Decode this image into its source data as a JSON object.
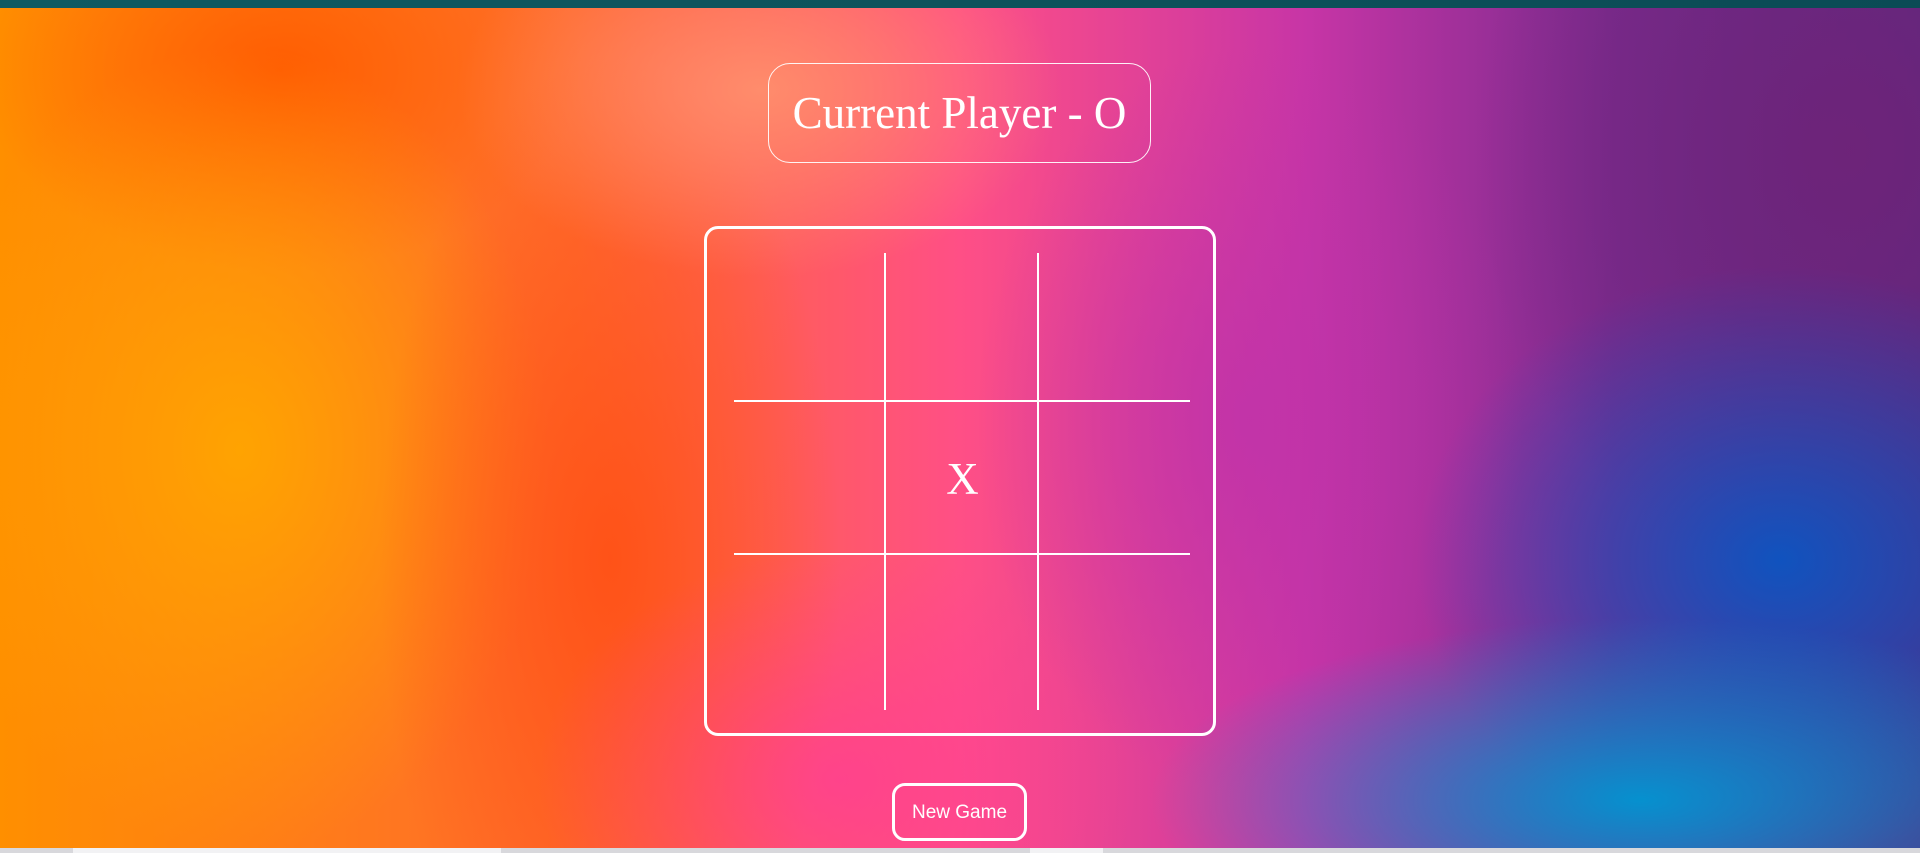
{
  "status": {
    "label": "Current Player - O"
  },
  "board": {
    "cells": [
      "",
      "",
      "",
      "",
      "X",
      "",
      "",
      "",
      ""
    ]
  },
  "controls": {
    "new_game_label": "New Game"
  }
}
